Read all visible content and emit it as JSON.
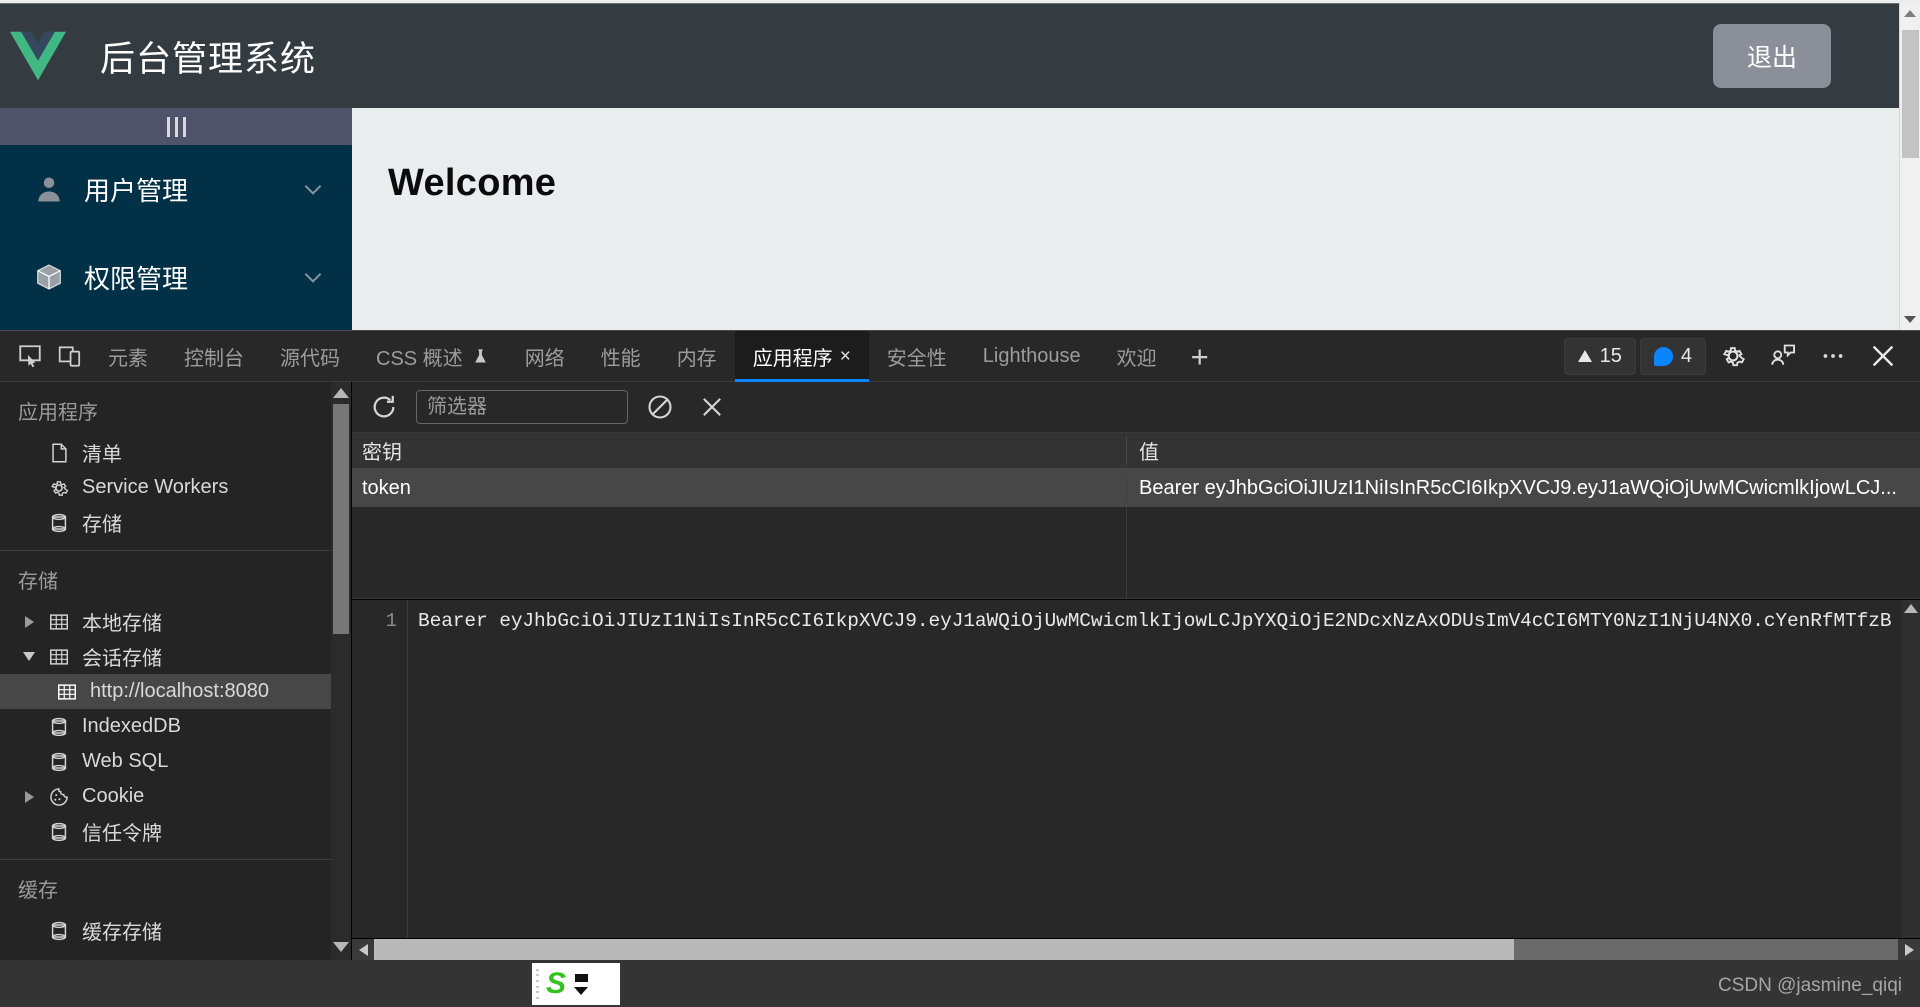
{
  "browser_page": {
    "header": {
      "logo": "vue-logo",
      "title": "后台管理系统",
      "logout_label": "退出"
    },
    "sidebar": {
      "collapse_toggle": "|||",
      "items": [
        {
          "label": "用户管理",
          "icon": "user-icon",
          "chevron": "chevron-down-icon"
        },
        {
          "label": "权限管理",
          "icon": "box-icon",
          "chevron": "chevron-down-icon"
        }
      ]
    },
    "content": {
      "welcome_title": "Welcome"
    }
  },
  "devtools": {
    "left_icons": [
      "inspect-element-icon",
      "device-toolbar-icon"
    ],
    "tabs": [
      {
        "label": "元素",
        "active": false
      },
      {
        "label": "控制台",
        "active": false
      },
      {
        "label": "源代码",
        "active": false
      },
      {
        "label": "CSS 概述",
        "active": false,
        "badge": "experiment-flask-icon"
      },
      {
        "label": "网络",
        "active": false
      },
      {
        "label": "性能",
        "active": false
      },
      {
        "label": "内存",
        "active": false
      },
      {
        "label": "应用程序",
        "active": true,
        "close": "×"
      },
      {
        "label": "安全性",
        "active": false
      },
      {
        "label": "Lighthouse",
        "active": false
      },
      {
        "label": "欢迎",
        "active": false
      }
    ],
    "add_tab_label": "+",
    "status": {
      "warnings_count": "15",
      "messages_count": "4"
    },
    "right_icons": [
      "settings-gear-icon",
      "feedback-icon",
      "more-options-icon",
      "close-devtools-icon"
    ],
    "application_panel": {
      "sections": [
        {
          "title": "应用程序",
          "items": [
            {
              "label": "清单",
              "icon": "manifest-file-icon",
              "arrow": "none",
              "indent": 1,
              "selected": false
            },
            {
              "label": "Service Workers",
              "icon": "gear-icon",
              "arrow": "none",
              "indent": 1,
              "selected": false
            },
            {
              "label": "存储",
              "icon": "database-icon",
              "arrow": "none",
              "indent": 1,
              "selected": false
            }
          ]
        },
        {
          "title": "存储",
          "items": [
            {
              "label": "本地存储",
              "icon": "table-grid-icon",
              "arrow": "collapsed",
              "indent": 1,
              "selected": false
            },
            {
              "label": "会话存储",
              "icon": "table-grid-icon",
              "arrow": "expanded",
              "indent": 1,
              "selected": false
            },
            {
              "label": "http://localhost:8080",
              "icon": "table-grid-icon",
              "arrow": "none",
              "indent": 2,
              "selected": true
            },
            {
              "label": "IndexedDB",
              "icon": "database-icon",
              "arrow": "none",
              "indent": 1,
              "selected": false
            },
            {
              "label": "Web SQL",
              "icon": "database-icon",
              "arrow": "none",
              "indent": 1,
              "selected": false
            },
            {
              "label": "Cookie",
              "icon": "cookie-icon",
              "arrow": "collapsed",
              "indent": 1,
              "selected": false
            },
            {
              "label": "信任令牌",
              "icon": "database-icon",
              "arrow": "none",
              "indent": 1,
              "selected": false
            }
          ]
        },
        {
          "title": "缓存",
          "items": [
            {
              "label": "缓存存储",
              "icon": "database-icon",
              "arrow": "none",
              "indent": 1,
              "selected": false
            }
          ]
        }
      ],
      "toolbar": {
        "refresh_icon": "refresh-icon",
        "filter_placeholder": "筛选器",
        "filter_value": "",
        "clear_all_icon": "clear-all-icon",
        "delete_selected_icon": "delete-selected-icon"
      },
      "table": {
        "columns": [
          "密钥",
          "值"
        ],
        "rows": [
          {
            "key": "token",
            "value": "Bearer eyJhbGciOiJIUzI1NiIsInR5cCI6IkpXVCJ9.eyJ1aWQiOjUwMCwicmlkIjowLCJ..."
          }
        ]
      },
      "value_preview": {
        "line_number": "1",
        "content": "Bearer eyJhbGciOiJIUzI1NiIsInR5cCI6IkpXVCJ9.eyJ1aWQiOjUwMCwicmlkIjowLCJpYXQiOjE2NDcxNzAxODUsImV4cCI6MTY0NzI1NjU4NX0.cYenRfMTfzB"
      }
    },
    "snip_widget": {
      "logo": "snipaste-s-logo"
    },
    "watermark": "CSDN @jasmine_qiqi"
  }
}
